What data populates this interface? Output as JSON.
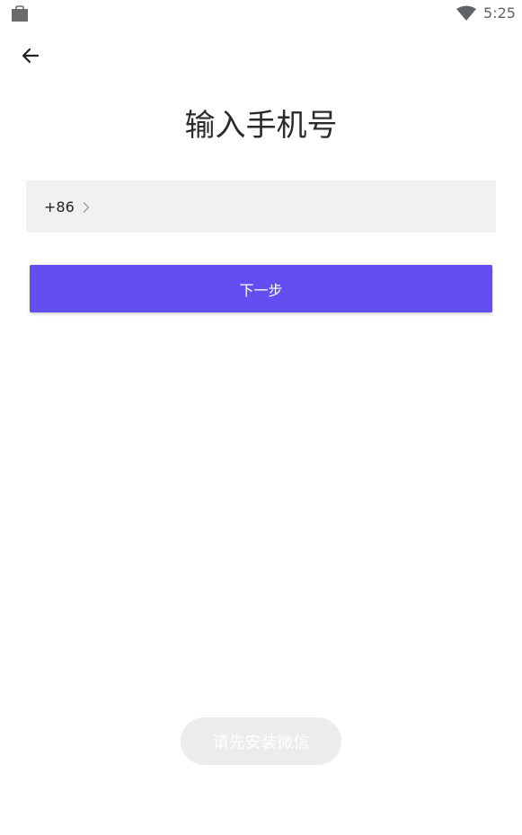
{
  "status_bar": {
    "time": "5:25",
    "left_icon": "bag-icon",
    "right_icon": "wifi-icon"
  },
  "header": {
    "back_icon": "arrow-left-icon"
  },
  "main": {
    "title": "输入手机号",
    "country_code": "+86",
    "country_chevron_icon": "chevron-right-icon",
    "phone_value": "",
    "next_label": "下一步"
  },
  "footer": {
    "wechat_label": "请先安装微信"
  },
  "colors": {
    "accent": "#634ef0",
    "input_bg": "#f1f1f1",
    "disabled_pill": "#ececec"
  }
}
